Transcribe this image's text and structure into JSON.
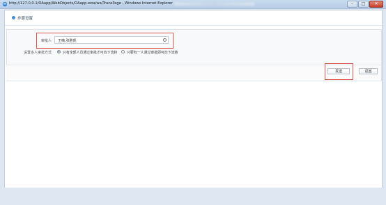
{
  "window": {
    "title": "http://127.0.0.1/OAapp/WebObjects/OAapp.woa/wa/TracePage - Windows Internet Explorer"
  },
  "header": {
    "step_title": "步骤设置"
  },
  "form": {
    "approver_label": "审批人",
    "approver_value": "王楠,张胜凯",
    "mode_label": "设置多人审批方式",
    "option_all": "只有全部人员通过审批才可向下流转",
    "option_any": "只要有一人通过审批即可向下流转"
  },
  "buttons": {
    "submit": "发送",
    "back": "返回"
  },
  "colors": {
    "highlight": "#d9534f",
    "accent": "#3f8ed6"
  }
}
